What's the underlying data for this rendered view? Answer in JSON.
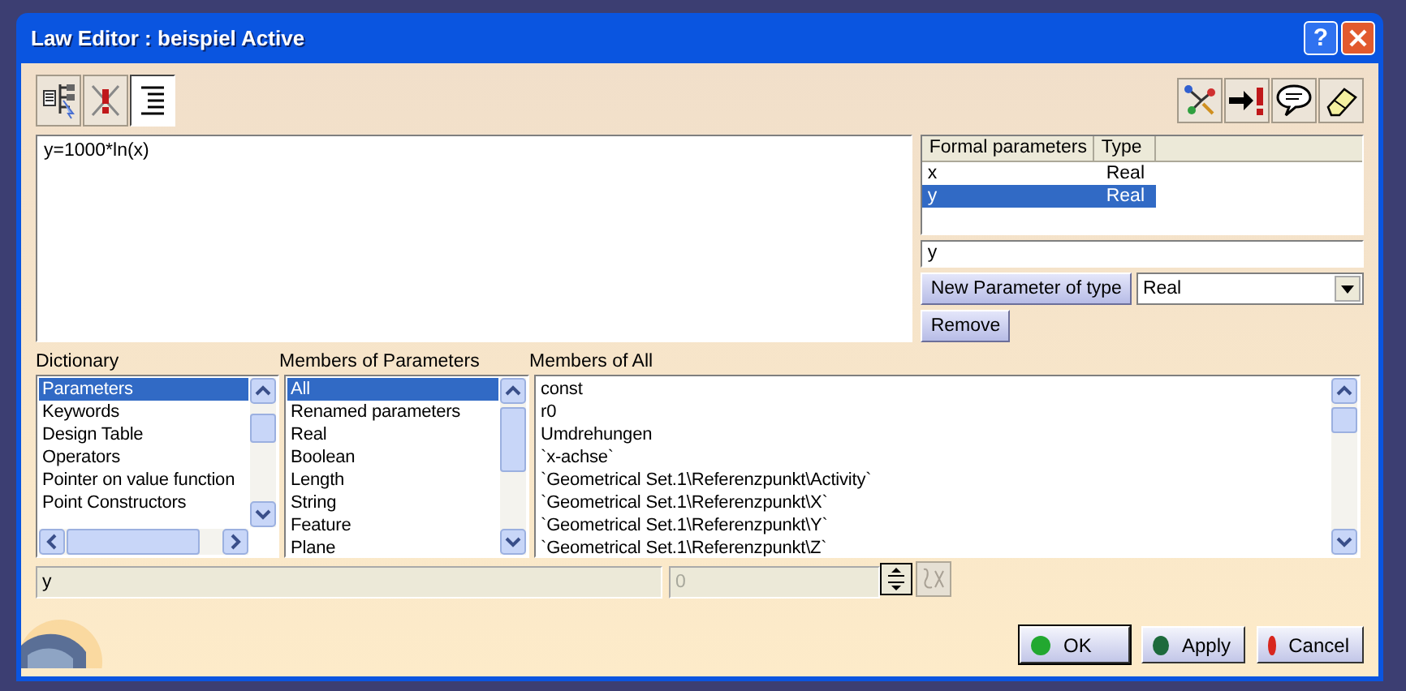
{
  "window": {
    "title": "Law Editor : beispiel Active",
    "help": "?"
  },
  "toolbar_left": [
    {
      "kind": "tree",
      "selected": false
    },
    {
      "kind": "error",
      "selected": false
    },
    {
      "kind": "lines",
      "selected": true
    }
  ],
  "toolbar_right": [
    {
      "kind": "network"
    },
    {
      "kind": "arrow"
    },
    {
      "kind": "bubble"
    },
    {
      "kind": "eraser"
    }
  ],
  "editor": {
    "value": "y=1000*ln(x)"
  },
  "formal_parameters": {
    "columns": [
      "Formal parameters",
      "Type"
    ],
    "rows": [
      {
        "cells": [
          "x",
          "Real"
        ],
        "selected": false
      },
      {
        "cells": [
          "y",
          "Real"
        ],
        "selected": true
      }
    ]
  },
  "name_field": {
    "value": "y"
  },
  "new_parameter_button": "New Parameter of type",
  "type_select": {
    "value": "Real"
  },
  "remove_button": "Remove",
  "dictionary": {
    "label": "Dictionary",
    "items": [
      {
        "text": "Parameters",
        "selected": true
      },
      {
        "text": "Keywords",
        "selected": false
      },
      {
        "text": "Design Table",
        "selected": false
      },
      {
        "text": "Operators",
        "selected": false
      },
      {
        "text": "Pointer on value function",
        "selected": false
      },
      {
        "text": "Point Constructors",
        "selected": false
      }
    ]
  },
  "members_of_parameters": {
    "label": "Members of Parameters",
    "items": [
      {
        "text": "All",
        "selected": true
      },
      {
        "text": "Renamed parameters",
        "selected": false
      },
      {
        "text": "Real",
        "selected": false
      },
      {
        "text": "Boolean",
        "selected": false
      },
      {
        "text": "Length",
        "selected": false
      },
      {
        "text": "String",
        "selected": false
      },
      {
        "text": "Feature",
        "selected": false
      },
      {
        "text": "Plane",
        "selected": false
      }
    ]
  },
  "members_of_all": {
    "label": "Members of All",
    "items": [
      "const",
      "r0",
      "Umdrehungen",
      "`x-achse`",
      "`Geometrical Set.1\\Referenzpunkt\\Activity`",
      "`Geometrical Set.1\\Referenzpunkt\\X`",
      "`Geometrical Set.1\\Referenzpunkt\\Y`",
      "`Geometrical Set.1\\Referenzpunkt\\Z`"
    ]
  },
  "value_field": {
    "value": "y"
  },
  "spin_field": {
    "value": "0",
    "disabled": true
  },
  "buttons": [
    {
      "label": "OK",
      "color": "#22a830"
    },
    {
      "label": "Apply",
      "color": "#1d6a3c"
    },
    {
      "label": "Cancel",
      "color": "#d8261e"
    }
  ]
}
